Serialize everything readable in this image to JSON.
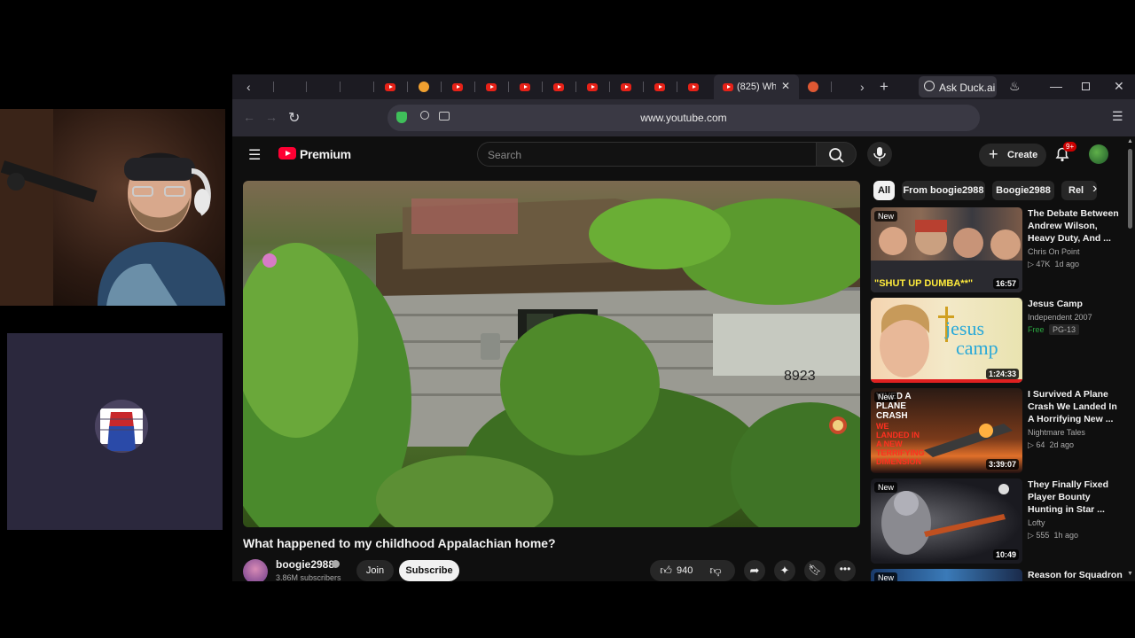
{
  "browser": {
    "active_tab_title": "(825) Wh",
    "duck_ai_label": "Ask Duck.ai",
    "url": "www.youtube.com"
  },
  "youtube": {
    "logo_text": "Premium",
    "search_placeholder": "Search",
    "create_label": "Create",
    "notification_badge": "9+",
    "video": {
      "title": "What happened to my childhood Appalachian home?",
      "channel": "boogie2988",
      "subscribers": "3.86M subscribers",
      "join_label": "Join",
      "subscribe_label": "Subscribe",
      "likes": "940",
      "house_number": "8923"
    },
    "chips": [
      "All",
      "From boogie2988",
      "Boogie2988",
      "Rel"
    ],
    "recommendations": [
      {
        "title_line1": "The Debate Between",
        "title_line2": "Andrew Wilson,",
        "title_line3": "Heavy Duty, And ...",
        "channel": "Chris On Point",
        "views": "47K",
        "age": "1d ago",
        "duration": "16:57",
        "badge": "New",
        "thumb_caption": "\"SHUT UP DUMBA**\""
      },
      {
        "title_line1": "Jesus Camp",
        "channel": "Independent 2007",
        "free_label": "Free",
        "rating": "PG-13",
        "duration": "1:24:33",
        "thumb_caption_1": "jesus",
        "thumb_caption_2": "camp"
      },
      {
        "title_line1": "I Survived A Plane",
        "title_line2": "Crash  We Landed In",
        "title_line3": "A Horrifying New ...",
        "channel": "Nightmare Tales",
        "views": "64",
        "age": "2d ago",
        "duration": "3:39:07",
        "badge": "New",
        "thumb_caption_1": "VIVED A PLANE CRASH",
        "thumb_caption_2": "WE LANDED IN A NEW TERRIFYING DIMENSION"
      },
      {
        "title_line1": "They Finally Fixed",
        "title_line2": "Player Bounty",
        "title_line3": "Hunting in Star ...",
        "channel": "Lofty",
        "views": "555",
        "age": "1h ago",
        "duration": "10:49",
        "badge": "New"
      },
      {
        "title_line1": "Reason for Squadron",
        "badge": "New"
      }
    ]
  },
  "colors": {
    "yt_red": "#ff0033",
    "page_bg": "#0f0f0f",
    "chip_active_bg": "#f1f1f1",
    "free_green": "#2ba640"
  }
}
